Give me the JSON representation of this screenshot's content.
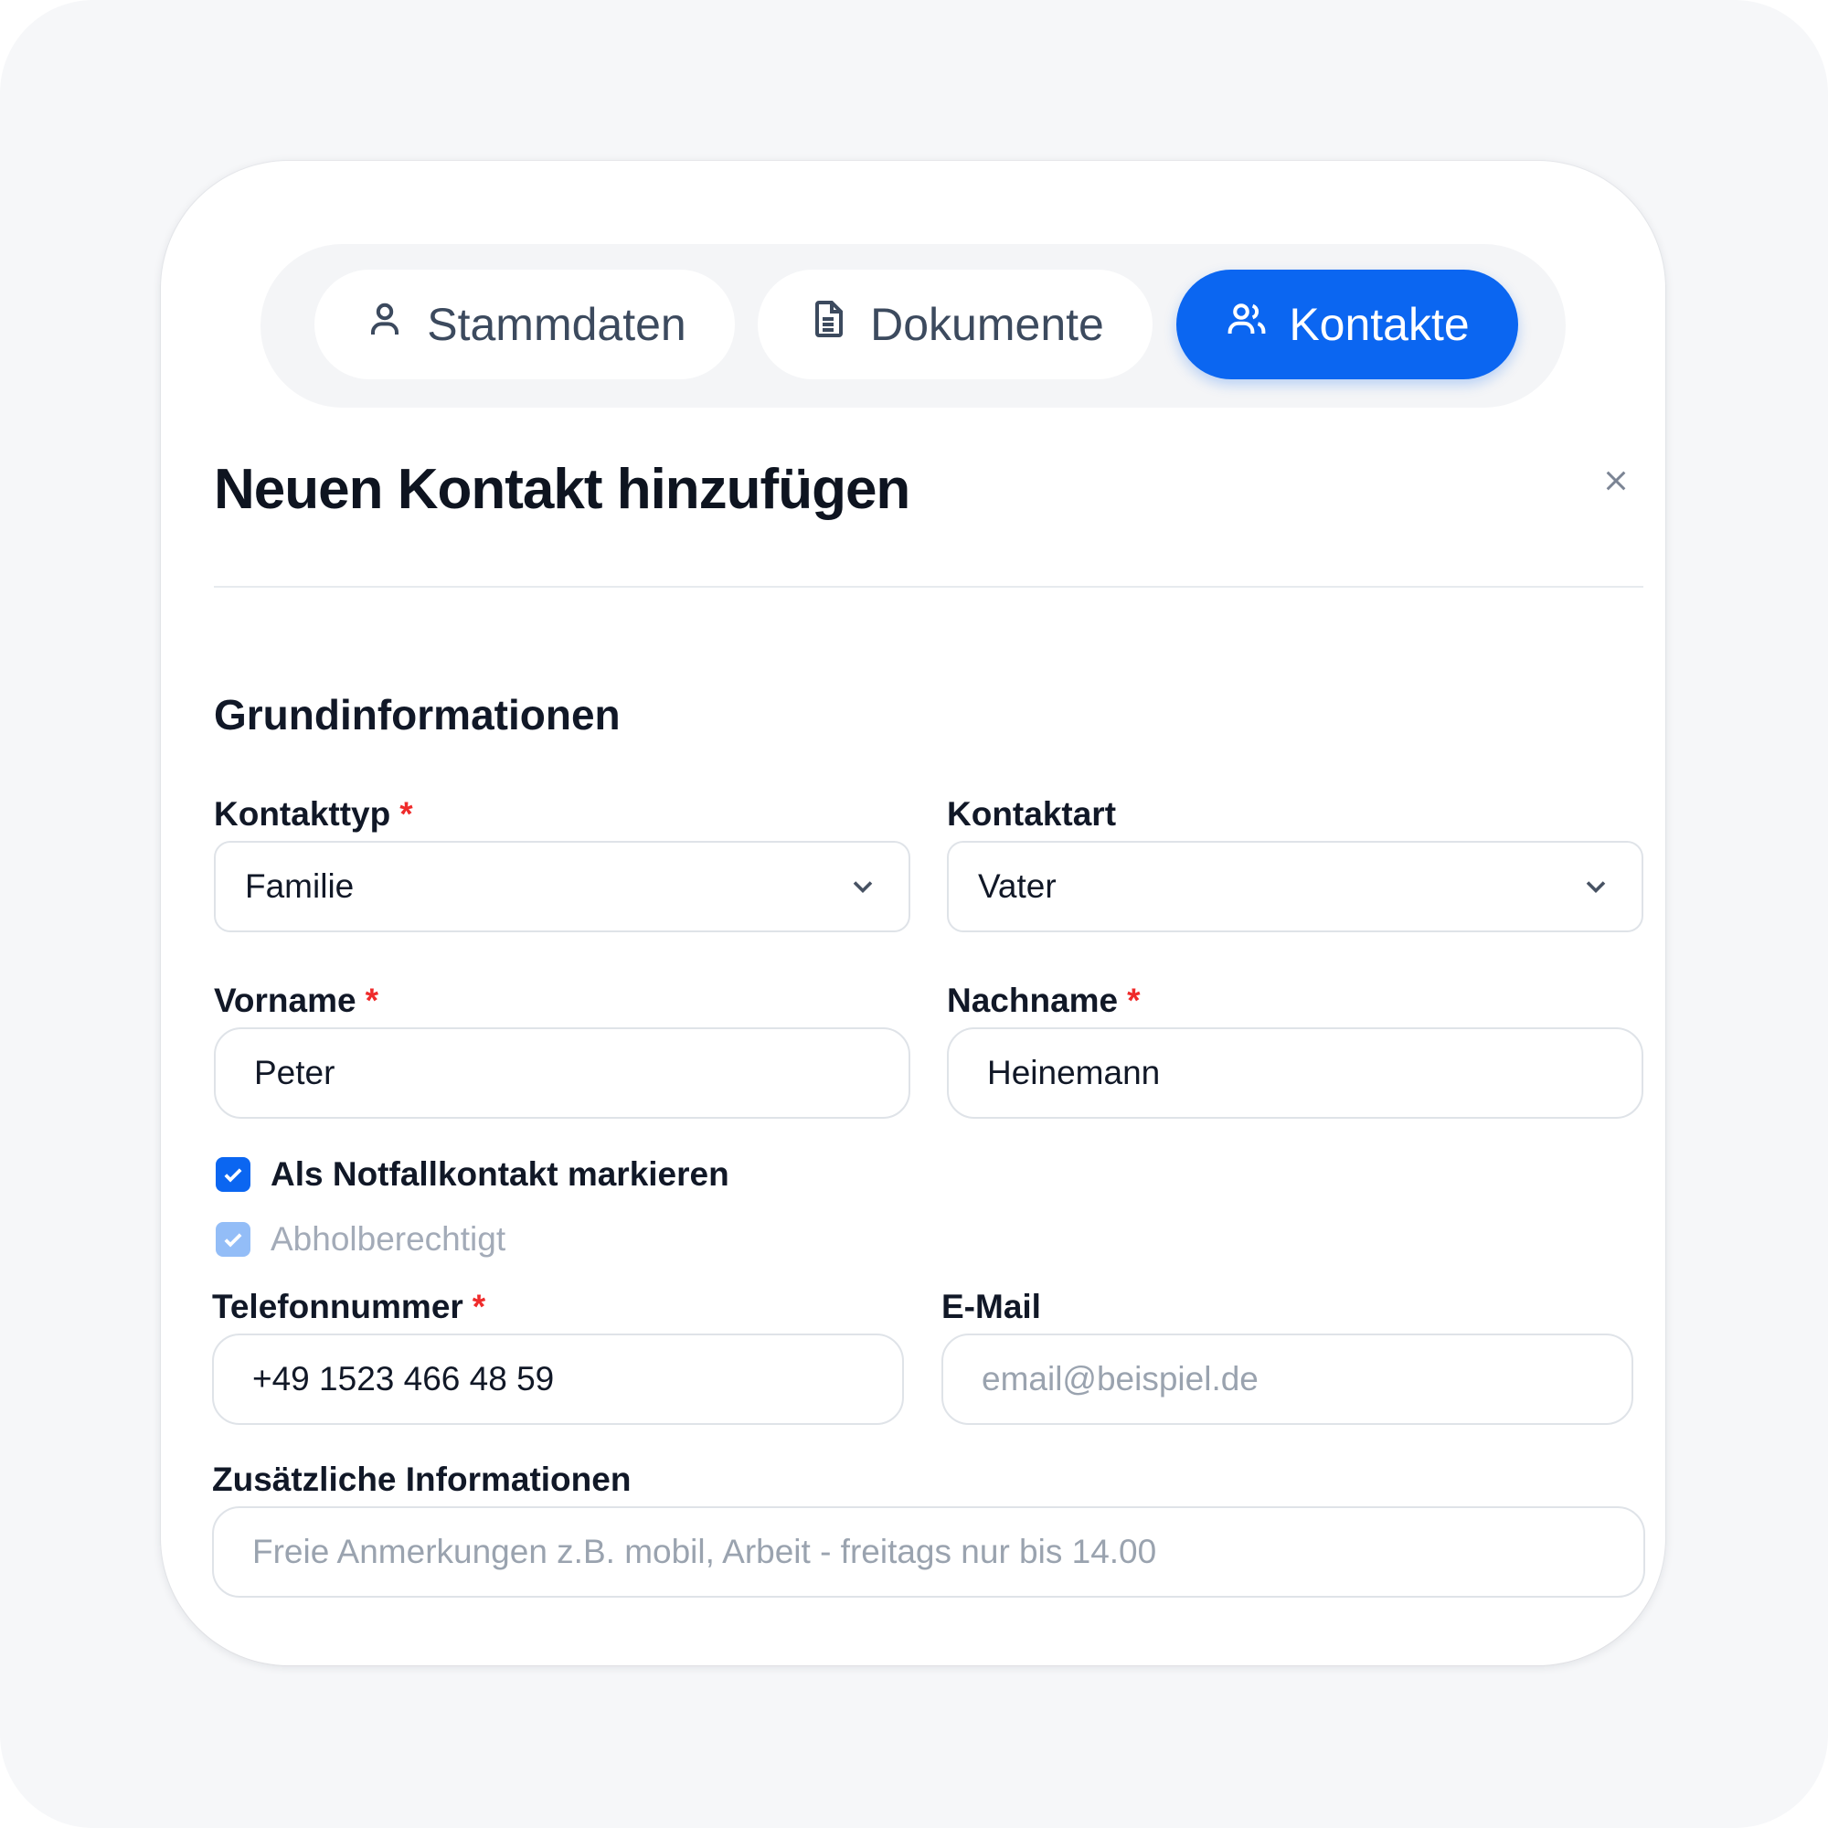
{
  "tabs": [
    {
      "label": "Stammdaten",
      "icon": "user-icon",
      "active": false
    },
    {
      "label": "Dokumente",
      "icon": "document-icon",
      "active": false
    },
    {
      "label": "Kontakte",
      "icon": "users-icon",
      "active": true
    }
  ],
  "dialog": {
    "title": "Neuen Kontakt hinzufügen",
    "close_icon": "close-icon"
  },
  "section": {
    "title": "Grundinformationen"
  },
  "fields": {
    "kontakttyp": {
      "label": "Kontakttyp",
      "required_mark": "*",
      "value": "Familie"
    },
    "kontaktart": {
      "label": "Kontaktart",
      "value": "Vater"
    },
    "vorname": {
      "label": "Vorname",
      "required_mark": "*",
      "value": "Peter"
    },
    "nachname": {
      "label": "Nachname",
      "required_mark": "*",
      "value": "Heinemann"
    },
    "telefon": {
      "label": "Telefonnummer",
      "required_mark": "*",
      "value": "+49 1523 466 48 59"
    },
    "email": {
      "label": "E-Mail",
      "value": "",
      "placeholder": "email@beispiel.de"
    },
    "zusatz": {
      "label": "Zusätzliche Informationen",
      "value": "",
      "placeholder": "Freie Anmerkungen z.B. mobil, Arbeit - freitags nur bis 14.00"
    }
  },
  "checkboxes": [
    {
      "label": "Als Notfallkontakt markieren",
      "checked": true,
      "disabled": false
    },
    {
      "label": "Abholberechtigt",
      "checked": true,
      "disabled": true
    }
  ],
  "colors": {
    "accent": "#0b66f1",
    "required": "#ef2b2b",
    "background": "#f6f7f9"
  }
}
